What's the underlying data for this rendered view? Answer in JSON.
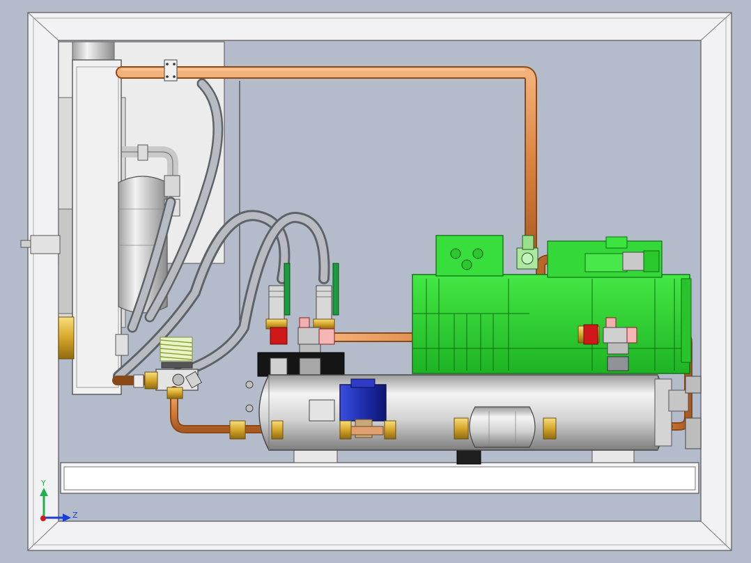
{
  "axis_triad": {
    "y_label": "Y",
    "z_label": "Z",
    "y_color": "#22b04a",
    "z_color": "#1a3fd6",
    "origin_color": "#d01818"
  },
  "colors": {
    "background": "#b4bccb",
    "frame": "#f2f2f4",
    "copper": "#d98a4a",
    "compressor_green": "#2ad12f",
    "hose_grey": "#8f9399",
    "vessel_grey": "#d6d6d6",
    "solenoid_blue": "#1f2fb0",
    "valve_red": "#d11818"
  }
}
